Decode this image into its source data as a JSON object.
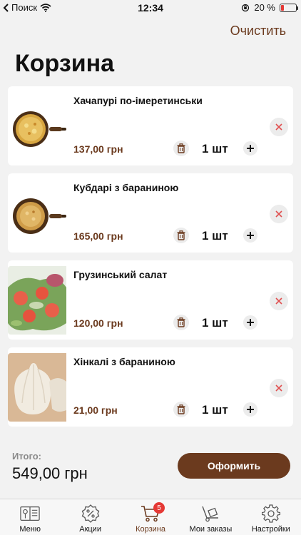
{
  "status_bar": {
    "carrier": "Поиск",
    "time": "12:34",
    "battery_percent": "20 %",
    "battery_level": 0.2,
    "battery_color": "#e53935"
  },
  "header": {
    "clear_label": "Очистить",
    "title": "Корзина"
  },
  "cart": {
    "items": [
      {
        "name": "Хачапурі по-імеретинськи",
        "price": "137,00 грн",
        "qty": "1 шт",
        "image": "khachapuri-in-pan"
      },
      {
        "name": "Кубдарі з бараниною",
        "price": "165,00 грн",
        "qty": "1 шт",
        "image": "kubdari-in-pan"
      },
      {
        "name": "Грузинський салат",
        "price": "120,00 грн",
        "qty": "1 шт",
        "image": "georgian-salad"
      },
      {
        "name": "Хінкалі з бараниною",
        "price": "21,00 грн",
        "qty": "1 шт",
        "image": "khinkali"
      }
    ]
  },
  "summary": {
    "total_label": "Итого:",
    "total_value": "549,00 грн",
    "checkout_label": "Оформить"
  },
  "tab_bar": {
    "tabs": [
      {
        "label": "Меню",
        "icon": "menu-book-icon"
      },
      {
        "label": "Акции",
        "icon": "discount-badge-icon"
      },
      {
        "label": "Корзина",
        "icon": "cart-icon",
        "badge": "5",
        "active": true
      },
      {
        "label": "Мои заказы",
        "icon": "hand-truck-icon"
      },
      {
        "label": "Настройки",
        "icon": "gear-icon"
      }
    ]
  },
  "colors": {
    "accent": "#6b3a1e",
    "background": "#f2f2f2",
    "badge": "#e53935"
  }
}
